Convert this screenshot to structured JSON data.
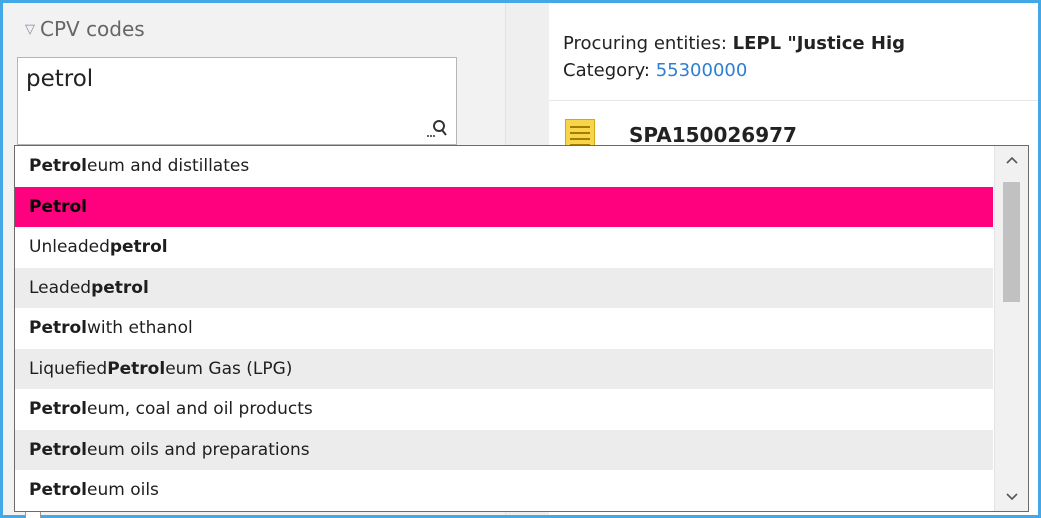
{
  "cpv": {
    "header": "CPV codes",
    "search_value": "petrol"
  },
  "entity": {
    "procuring_label": "Procuring entities: ",
    "procuring_value": "LEPL \"Justice Hig",
    "category_label": "Category: ",
    "category_value": "55300000",
    "code": "SPA150026977"
  },
  "dropdown": {
    "items": [
      {
        "prefix": "",
        "bold": "Petrol",
        "suffix": "eum and distillates"
      },
      {
        "prefix": "",
        "bold": "Petrol",
        "suffix": ""
      },
      {
        "prefix": "Unleaded ",
        "bold": "petrol",
        "suffix": ""
      },
      {
        "prefix": "Leaded ",
        "bold": "petrol",
        "suffix": ""
      },
      {
        "prefix": "",
        "bold": "Petrol",
        "suffix": " with ethanol"
      },
      {
        "prefix": "Liquefied ",
        "bold": "Petrol",
        "suffix": "eum Gas (LPG)"
      },
      {
        "prefix": "",
        "bold": "Petrol",
        "suffix": "eum, coal and oil products"
      },
      {
        "prefix": "",
        "bold": "Petrol",
        "suffix": "eum oils and preparations"
      },
      {
        "prefix": "",
        "bold": "Petrol",
        "suffix": "eum oils"
      }
    ],
    "selected_index": 1
  },
  "icons": {
    "header_toggle": "triangle-down-icon",
    "search": "search-icon",
    "scroll_up": "chevron-up-icon",
    "scroll_down": "chevron-down-icon",
    "document": "document-icon"
  },
  "colors": {
    "accent_border": "#45a8e6",
    "selected_bg": "#ff007f",
    "link_blue": "#2f7fd1"
  }
}
